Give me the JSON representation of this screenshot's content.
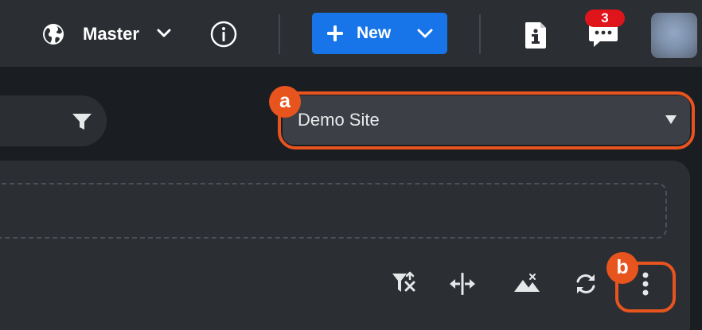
{
  "header": {
    "environment_label": "Master",
    "new_button_label": "New",
    "notification_count": "3",
    "icons": [
      "globe-icon",
      "chevron-down-icon",
      "info-circle-icon",
      "plus-icon",
      "document-info-icon",
      "chat-icon",
      "avatar"
    ]
  },
  "filter": {
    "icon": "filter-icon"
  },
  "site_selector": {
    "selected_value": "Demo Site"
  },
  "toolbar": {
    "icons": [
      "filter-remove-icon",
      "split-horizontal-icon",
      "mountains-icon",
      "refresh-icon",
      "more-vertical-icon"
    ]
  },
  "annotations": {
    "marker_a": "a",
    "marker_b": "b"
  },
  "colors": {
    "header_bg": "#2b2e33",
    "page_bg": "#1a1d22",
    "primary": "#1774e9",
    "badge": "#e0141b",
    "highlight": "#e8541e",
    "select_bg": "#3c3f45"
  }
}
